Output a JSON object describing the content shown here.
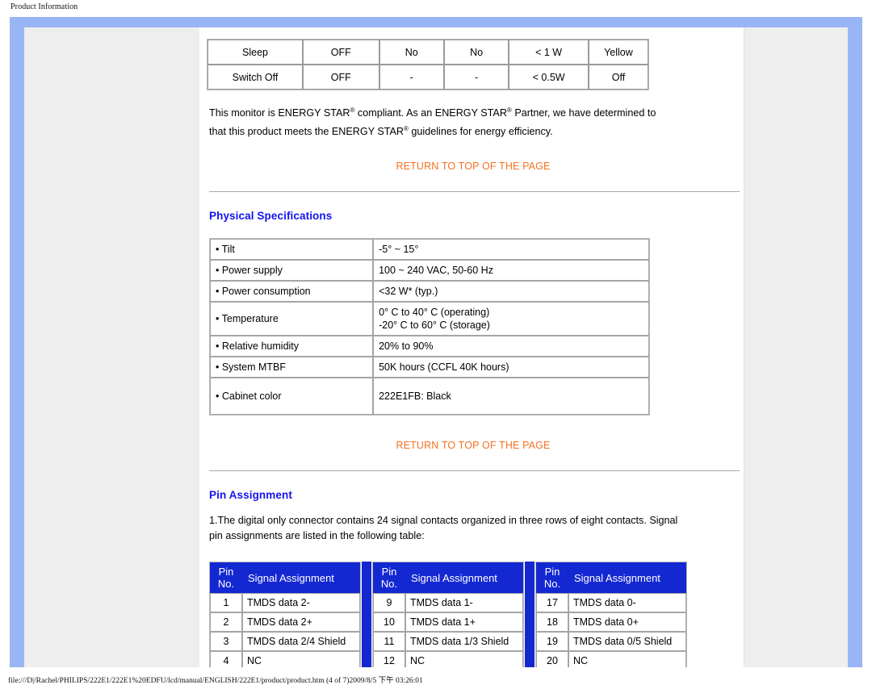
{
  "print": {
    "header": "Product Information",
    "footer": "file:///D|/Rachel/PHILIPS/222E1/222E1%20EDFU/lcd/manual/ENGLISH/222E1/product/product.htm (4 of 7)2009/8/5 下午 03:26:01"
  },
  "colors": {
    "frame_blue": "#99b5f5",
    "heading_blue": "#1414f0",
    "link_orange": "#f47122",
    "table_header_blue": "#1428d2",
    "gutter_gray": "#eeeeee"
  },
  "power_table": {
    "rows": [
      [
        "Sleep",
        "OFF",
        "No",
        "No",
        "< 1 W",
        "Yellow"
      ],
      [
        "Switch Off",
        "OFF",
        "-",
        "-",
        "< 0.5W",
        "Off"
      ]
    ]
  },
  "energy_star": {
    "line1_a": "This monitor is ENERGY STAR",
    "line1_sup": "®",
    "line1_b": " compliant. As an ENERGY STAR",
    "line1_sup2": "®",
    "line1_c": " Partner, we have",
    "line2_a": "determined to that this product meets the ENERGY STAR",
    "line2_sup": "®",
    "line2_b": " guidelines for energy efficiency."
  },
  "return_link_1": "RETURN TO TOP OF THE PAGE",
  "return_link_2": "RETURN TO TOP OF THE PAGE",
  "physical": {
    "title": "Physical Specifications",
    "rows": [
      {
        "label": "• Tilt",
        "value": "-5° ~ 15°"
      },
      {
        "label": "• Power supply",
        "value": "100 ~ 240 VAC, 50-60 Hz"
      },
      {
        "label": "• Power consumption",
        "value": "<32 W* (typ.)"
      },
      {
        "label": "• Temperature",
        "value": "0° C to 40° C (operating)\n-20° C to 60° C (storage)"
      },
      {
        "label": "• Relative humidity",
        "value": "20% to 90%"
      },
      {
        "label": "• System MTBF",
        "value": "50K hours (CCFL 40K hours)"
      },
      {
        "label": "• Cabinet color",
        "value": "222E1FB: Black"
      }
    ]
  },
  "pin": {
    "title": "Pin Assignment",
    "intro_line1": "1.The digital only connector contains 24 signal contacts organized in three rows of eight contacts. Signal pin",
    "intro_line2": "assignments are listed in the following table:",
    "header_pin_line1": "Pin",
    "header_pin_line2": "No.",
    "header_signal": "Signal Assignment",
    "tables": [
      {
        "rows": [
          {
            "no": "1",
            "signal": "TMDS data 2-"
          },
          {
            "no": "2",
            "signal": "TMDS data 2+"
          },
          {
            "no": "3",
            "signal": "TMDS data 2/4 Shield"
          },
          {
            "no": "4",
            "signal": "NC"
          }
        ]
      },
      {
        "rows": [
          {
            "no": "9",
            "signal": "TMDS data 1-"
          },
          {
            "no": "10",
            "signal": "TMDS data 1+"
          },
          {
            "no": "11",
            "signal": "TMDS data 1/3 Shield"
          },
          {
            "no": "12",
            "signal": "NC"
          }
        ]
      },
      {
        "rows": [
          {
            "no": "17",
            "signal": "TMDS data 0-"
          },
          {
            "no": "18",
            "signal": "TMDS data 0+"
          },
          {
            "no": "19",
            "signal": "TMDS data 0/5 Shield"
          },
          {
            "no": "20",
            "signal": "NC"
          }
        ]
      }
    ]
  }
}
